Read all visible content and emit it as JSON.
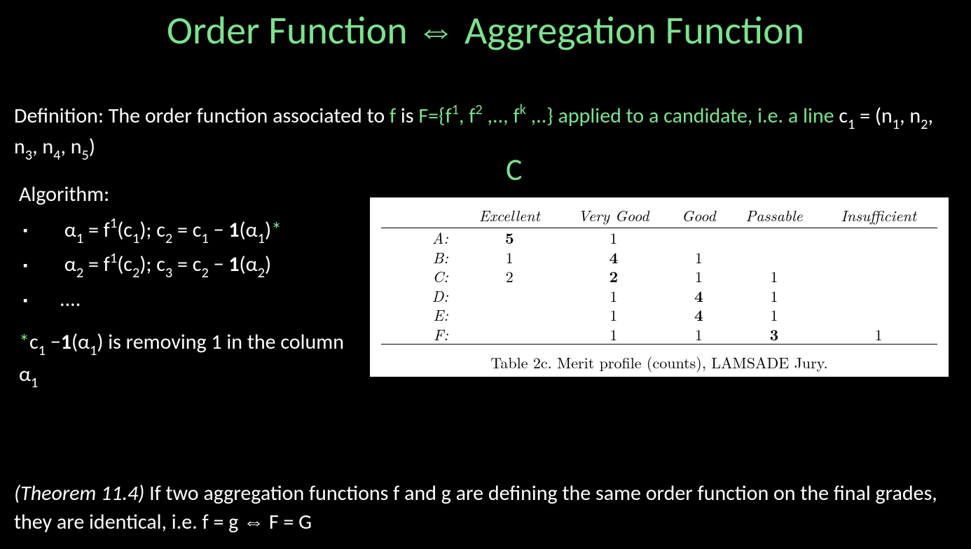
{
  "title": "Order Function ⇔ Aggregation Function",
  "definition": {
    "lead": "Definition: The order function associated to ",
    "f": "f",
    "is": " is ",
    "fset_pre": "F={f",
    "fset_mid1": ", f",
    "fset_mid2": " ,.., f",
    "fset_post": " ,..}",
    "applied": " applied to a candidate, i.e. a ",
    "line": "line",
    "tuple_pre": " c",
    "tuple_eq": " = (n",
    "tuple_c2": ", n",
    "tuple_c3": ", n",
    "tuple_c4": ", n",
    "tuple_close": ")"
  },
  "c_label": "C",
  "algorithm": {
    "heading": "Algorithm:",
    "step1_a": "α",
    "step1_b": " = f",
    "step1_c": "(c",
    "step1_d": "); c",
    "step1_e": " = c",
    "step1_f": " − ",
    "step1_g": "1",
    "step1_h": "(α",
    "step1_i": ")",
    "step1_star": "*",
    "step2_a": "α",
    "step2_b": " = f",
    "step2_c": "(c",
    "step2_d": "); c",
    "step2_e": " = c",
    "step2_f": " − ",
    "step2_g": "1",
    "step2_h": "(α",
    "step2_i": ")",
    "step3": "...."
  },
  "footnote": {
    "star": "*",
    "a": "c",
    "b": " −",
    "c": "1",
    "d": "(α",
    "e": ") is removing 1 in the column α"
  },
  "table": {
    "headers": [
      "",
      "Excellent",
      "Very Good",
      "Good",
      "Passable",
      "Insufficient"
    ],
    "rows": [
      {
        "label": "A:",
        "cells": [
          "5",
          "1",
          "",
          "",
          ""
        ],
        "bold_col": 0
      },
      {
        "label": "B:",
        "cells": [
          "1",
          "4",
          "1",
          "",
          ""
        ],
        "bold_col": 1
      },
      {
        "label": "C:",
        "cells": [
          "2",
          "2",
          "1",
          "1",
          ""
        ],
        "bold_col": 1
      },
      {
        "label": "D:",
        "cells": [
          "",
          "1",
          "4",
          "1",
          ""
        ],
        "bold_col": 2
      },
      {
        "label": "E:",
        "cells": [
          "",
          "1",
          "4",
          "1",
          ""
        ],
        "bold_col": 2
      },
      {
        "label": "F:",
        "cells": [
          "",
          "1",
          "1",
          "3",
          "1"
        ],
        "bold_col": 3
      }
    ],
    "caption": "Table 2c. Merit profile (counts), LAMSADE Jury."
  },
  "theorem": {
    "label": "(Theorem 11.4)",
    "text": " If two aggregation functions f and g are defining the same order function on the final grades, they are identical, i.e. f = g ⇔ F = G"
  }
}
